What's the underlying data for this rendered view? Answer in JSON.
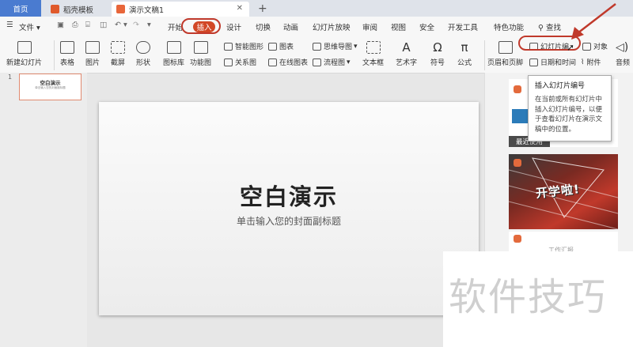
{
  "tabs": {
    "home": "首页",
    "template": "稻壳模板",
    "doc": "演示文稿1",
    "add": "+"
  },
  "menu": {
    "file": "文件",
    "items": [
      "开始",
      "插入",
      "设计",
      "切换",
      "动画",
      "幻灯片放映",
      "审阅",
      "视图",
      "安全",
      "开发工具",
      "特色功能"
    ],
    "search": "查找"
  },
  "ribbon": {
    "new_slide": "新建幻灯片",
    "table": "表格",
    "picture": "图片",
    "screenshot": "截屏",
    "shape": "形状",
    "icon_lib": "图标库",
    "func_chart": "功能图",
    "smart_art": "智能图形",
    "chart": "图表",
    "relation": "关系图",
    "online_chart": "在线图表",
    "mind_map": "思维导图",
    "flowchart": "流程图",
    "textbox": "文本框",
    "art_text": "艺术字",
    "symbol": "符号",
    "formula": "公式",
    "header_footer": "页眉和页脚",
    "slide_number": "幻灯片编",
    "object": "对象",
    "date_time": "日期和时间",
    "attachment": "附件",
    "audio": "音频"
  },
  "thumbnail": {
    "title": "空白演示",
    "subtitle": "单击输入您的封面副标题"
  },
  "slide": {
    "title": "空白演示",
    "subtitle": "单击输入您的封面副标题"
  },
  "tooltip": {
    "title": "插入幻灯片编号",
    "body": "在当前或所有幻灯片中插入幻灯片编号，以便于查看幻灯片在演示文稿中的位置。"
  },
  "right_panel": {
    "recent": "最近使用",
    "card2_text": "开学啦!",
    "card3_text": "工作汇报"
  },
  "watermark": "软件技巧",
  "colors": {
    "accent": "#d24726",
    "home_tab": "#4a7bd0",
    "annotation": "#c0392b"
  }
}
